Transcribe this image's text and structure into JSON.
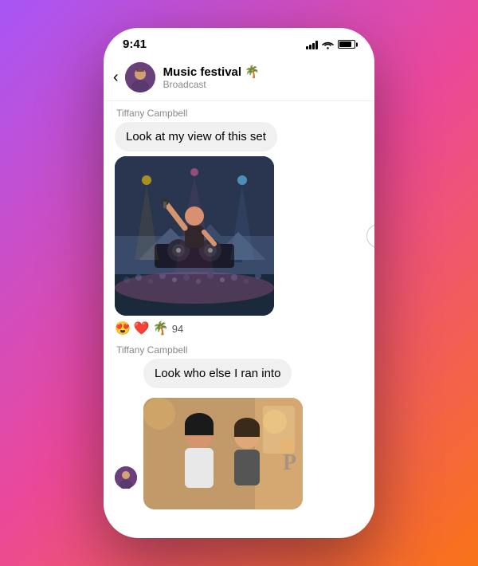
{
  "phone": {
    "status_bar": {
      "time": "9:41",
      "signal": "signal",
      "wifi": "wifi",
      "battery": "battery"
    },
    "header": {
      "back_label": "‹",
      "title": "Music festival 🌴",
      "subtitle": "Broadcast"
    },
    "messages": [
      {
        "id": "msg1",
        "sender": "Tiffany Campbell",
        "text": "Look at my view of this set",
        "type": "text_with_image",
        "reactions": [
          "😍",
          "❤️",
          "🌴"
        ],
        "reaction_count": "94"
      },
      {
        "id": "msg2",
        "sender": "Tiffany Campbell",
        "text": "Look who else I ran into",
        "type": "text_with_image"
      }
    ],
    "forward_icon": "▷"
  }
}
